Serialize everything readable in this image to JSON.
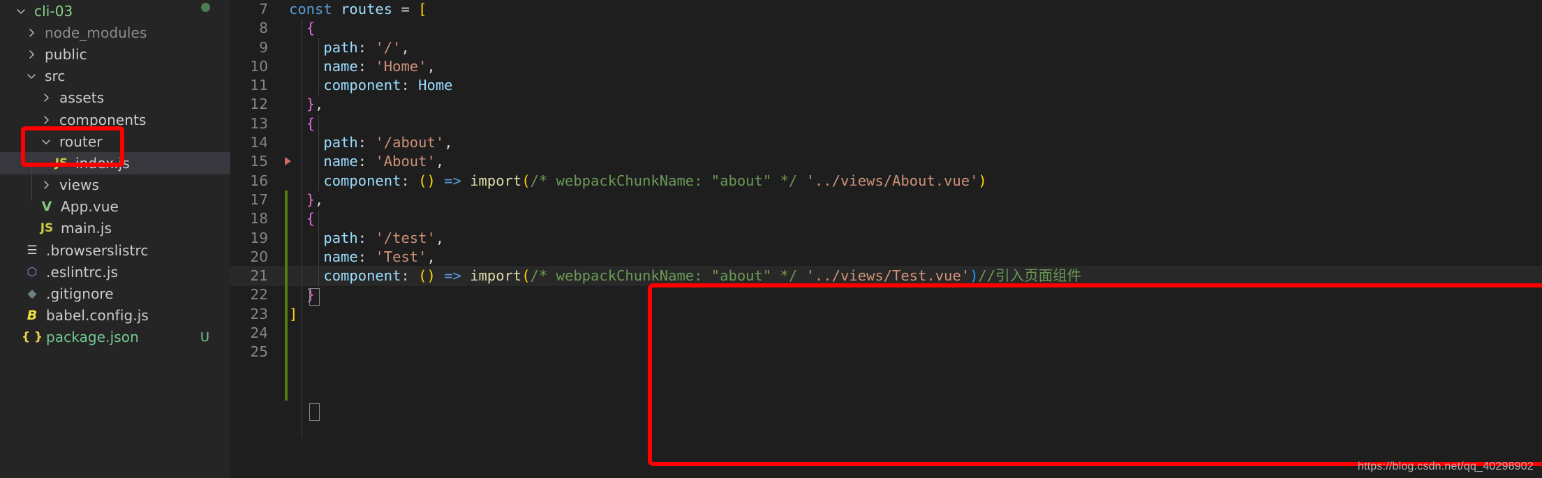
{
  "explorer": {
    "project": {
      "name": "cli-03",
      "expanded": true,
      "status_dot_color": "#4d7c4d"
    },
    "items": [
      {
        "label": "node_modules",
        "kind": "folder",
        "expanded": false,
        "depth": 1,
        "icon": "chevron-right-icon",
        "color": "#8c8c8c"
      },
      {
        "label": "public",
        "kind": "folder",
        "expanded": false,
        "depth": 1,
        "icon": "chevron-right-icon",
        "color": "#cccccc"
      },
      {
        "label": "src",
        "kind": "folder",
        "expanded": true,
        "depth": 1,
        "icon": "chevron-down-icon",
        "color": "#cccccc"
      },
      {
        "label": "assets",
        "kind": "folder",
        "expanded": false,
        "depth": 2,
        "icon": "chevron-right-icon",
        "color": "#cccccc"
      },
      {
        "label": "components",
        "kind": "folder",
        "expanded": false,
        "depth": 2,
        "icon": "chevron-right-icon",
        "color": "#cccccc"
      },
      {
        "label": "router",
        "kind": "folder",
        "expanded": true,
        "depth": 2,
        "icon": "chevron-down-icon",
        "color": "#cccccc",
        "highlighted": true
      },
      {
        "label": "index.js",
        "kind": "file",
        "depth": 3,
        "icon": "js-file-icon",
        "icon_text": "JS",
        "icon_color": "#cbcb41",
        "color": "#cccccc",
        "selected": true,
        "highlighted": true
      },
      {
        "label": "views",
        "kind": "folder",
        "expanded": false,
        "depth": 2,
        "icon": "chevron-right-icon",
        "color": "#cccccc"
      },
      {
        "label": "App.vue",
        "kind": "file",
        "depth": 2,
        "icon": "vue-file-icon",
        "icon_text": "V",
        "icon_color": "#81c784",
        "color": "#cccccc"
      },
      {
        "label": "main.js",
        "kind": "file",
        "depth": 2,
        "icon": "js-file-icon",
        "icon_text": "JS",
        "icon_color": "#cbcb41",
        "color": "#cccccc"
      },
      {
        "label": ".browserslistrc",
        "kind": "file",
        "depth": 1,
        "icon": "config-lines-icon",
        "icon_text": "☰",
        "icon_color": "#d4d4d4",
        "color": "#cccccc"
      },
      {
        "label": ".eslintrc.js",
        "kind": "file",
        "depth": 1,
        "icon": "eslint-file-icon",
        "icon_text": "⬡",
        "icon_color": "#b57edc",
        "color": "#cccccc"
      },
      {
        "label": ".gitignore",
        "kind": "file",
        "depth": 1,
        "icon": "git-file-icon",
        "icon_text": "◆",
        "icon_color": "#6d8086",
        "color": "#cccccc"
      },
      {
        "label": "babel.config.js",
        "kind": "file",
        "depth": 1,
        "icon": "babel-file-icon",
        "icon_text": "B",
        "icon_color": "#f0e040",
        "color": "#cccccc"
      },
      {
        "label": "package.json",
        "kind": "file",
        "depth": 1,
        "icon": "json-file-icon",
        "icon_text": "{ }",
        "icon_color": "#e8d44d",
        "color": "#73c991",
        "badge": "U",
        "badge_color": "#73c991"
      }
    ]
  },
  "editor": {
    "lines": [
      {
        "num": "7",
        "tokens": [
          {
            "t": "const",
            "c": "t-key"
          },
          {
            "t": " ",
            "c": "t-punc"
          },
          {
            "t": "routes",
            "c": "t-var"
          },
          {
            "t": " ",
            "c": "t-punc"
          },
          {
            "t": "=",
            "c": "t-punc"
          },
          {
            "t": " ",
            "c": "t-punc"
          },
          {
            "t": "[",
            "c": "t-brk-y"
          }
        ],
        "indent": 0
      },
      {
        "num": "8",
        "tokens": [
          {
            "t": "  ",
            "c": "t-punc"
          },
          {
            "t": "{",
            "c": "t-brk-p"
          }
        ],
        "indent": 1
      },
      {
        "num": "9",
        "tokens": [
          {
            "t": "    ",
            "c": "t-punc"
          },
          {
            "t": "path",
            "c": "t-var"
          },
          {
            "t": ": ",
            "c": "t-punc"
          },
          {
            "t": "'/'",
            "c": "t-str"
          },
          {
            "t": ",",
            "c": "t-punc"
          }
        ],
        "indent": 2
      },
      {
        "num": "10",
        "tokens": [
          {
            "t": "    ",
            "c": "t-punc"
          },
          {
            "t": "name",
            "c": "t-var"
          },
          {
            "t": ": ",
            "c": "t-punc"
          },
          {
            "t": "'Home'",
            "c": "t-str"
          },
          {
            "t": ",",
            "c": "t-punc"
          }
        ],
        "indent": 2
      },
      {
        "num": "11",
        "tokens": [
          {
            "t": "    ",
            "c": "t-punc"
          },
          {
            "t": "component",
            "c": "t-var"
          },
          {
            "t": ": ",
            "c": "t-punc"
          },
          {
            "t": "Home",
            "c": "t-type"
          }
        ],
        "indent": 2
      },
      {
        "num": "12",
        "tokens": [
          {
            "t": "  ",
            "c": "t-punc"
          },
          {
            "t": "}",
            "c": "t-brk-p"
          },
          {
            "t": ",",
            "c": "t-punc"
          }
        ],
        "indent": 1
      },
      {
        "num": "13",
        "tokens": [
          {
            "t": "  ",
            "c": "t-punc"
          },
          {
            "t": "{",
            "c": "t-brk-p"
          }
        ],
        "indent": 1
      },
      {
        "num": "14",
        "tokens": [
          {
            "t": "    ",
            "c": "t-punc"
          },
          {
            "t": "path",
            "c": "t-var"
          },
          {
            "t": ": ",
            "c": "t-punc"
          },
          {
            "t": "'/about'",
            "c": "t-str"
          },
          {
            "t": ",",
            "c": "t-punc"
          }
        ],
        "indent": 2
      },
      {
        "num": "15",
        "tokens": [
          {
            "t": "    ",
            "c": "t-punc"
          },
          {
            "t": "name",
            "c": "t-var"
          },
          {
            "t": ": ",
            "c": "t-punc"
          },
          {
            "t": "'About'",
            "c": "t-str"
          },
          {
            "t": ",",
            "c": "t-punc"
          }
        ],
        "indent": 2
      },
      {
        "num": "16",
        "tokens": [
          {
            "t": "    ",
            "c": "t-punc"
          },
          {
            "t": "component",
            "c": "t-var"
          },
          {
            "t": ": ",
            "c": "t-punc"
          },
          {
            "t": "()",
            "c": "t-brk-y"
          },
          {
            "t": " ",
            "c": "t-punc"
          },
          {
            "t": "=>",
            "c": "t-arrow"
          },
          {
            "t": " ",
            "c": "t-punc"
          },
          {
            "t": "import",
            "c": "t-fn"
          },
          {
            "t": "(",
            "c": "t-brk-y"
          },
          {
            "t": "/* webpackChunkName: \"about\" */",
            "c": "t-cmt"
          },
          {
            "t": " ",
            "c": "t-punc"
          },
          {
            "t": "'../views/About.vue'",
            "c": "t-str"
          },
          {
            "t": ")",
            "c": "t-brk-y"
          }
        ],
        "indent": 2,
        "change_marker": "red-triangle"
      },
      {
        "num": "17",
        "tokens": [
          {
            "t": "  ",
            "c": "t-punc"
          },
          {
            "t": "}",
            "c": "t-brk-p"
          },
          {
            "t": ",",
            "c": "t-punc"
          }
        ],
        "indent": 1
      },
      {
        "num": "18",
        "tokens": [
          {
            "t": "  ",
            "c": "t-punc"
          },
          {
            "t": "{",
            "c": "t-brk-p"
          }
        ],
        "indent": 1,
        "bracket_match": true
      },
      {
        "num": "19",
        "tokens": [
          {
            "t": "    ",
            "c": "t-punc"
          },
          {
            "t": "path",
            "c": "t-var"
          },
          {
            "t": ": ",
            "c": "t-punc"
          },
          {
            "t": "'/test'",
            "c": "t-str"
          },
          {
            "t": ",",
            "c": "t-punc"
          }
        ],
        "indent": 2
      },
      {
        "num": "20",
        "tokens": [
          {
            "t": "    ",
            "c": "t-punc"
          },
          {
            "t": "name",
            "c": "t-var"
          },
          {
            "t": ": ",
            "c": "t-punc"
          },
          {
            "t": "'Test'",
            "c": "t-str"
          },
          {
            "t": ",",
            "c": "t-punc"
          }
        ],
        "indent": 2
      },
      {
        "num": "21",
        "tokens": [
          {
            "t": "    ",
            "c": "t-punc"
          },
          {
            "t": "component",
            "c": "t-var"
          },
          {
            "t": ": ",
            "c": "t-punc"
          },
          {
            "t": "()",
            "c": "t-brk-y"
          },
          {
            "t": " ",
            "c": "t-punc"
          },
          {
            "t": "=>",
            "c": "t-arrow"
          },
          {
            "t": " ",
            "c": "t-punc"
          },
          {
            "t": "import",
            "c": "t-fn"
          },
          {
            "t": "(",
            "c": "t-brk-y"
          },
          {
            "t": "/* webpackChunkName: \"about\" */",
            "c": "t-cmt"
          },
          {
            "t": " ",
            "c": "t-punc"
          },
          {
            "t": "'../views/Test.vue'",
            "c": "t-str"
          },
          {
            "t": ")",
            "c": "t-brk-b"
          },
          {
            "t": "//引入页面组件",
            "c": "t-cmt"
          }
        ],
        "indent": 2,
        "current": true
      },
      {
        "num": "22",
        "tokens": [
          {
            "t": "  ",
            "c": "t-punc"
          },
          {
            "t": "}",
            "c": "t-brk-p"
          }
        ],
        "indent": 1,
        "bracket_match": true
      },
      {
        "num": "23",
        "tokens": [
          {
            "t": "]",
            "c": "t-brk-y"
          }
        ],
        "indent": 0
      },
      {
        "num": "24",
        "tokens": [],
        "indent": 0
      },
      {
        "num": "25",
        "tokens": [],
        "indent": 0
      }
    ]
  },
  "annotations": {
    "color": "#ff0000",
    "sidebar_box_target": "router-folder-and-index-js",
    "code_box_target": "test-route-object-lines-18-23"
  },
  "watermark": {
    "text": "https://blog.csdn.net/qq_40298902"
  }
}
